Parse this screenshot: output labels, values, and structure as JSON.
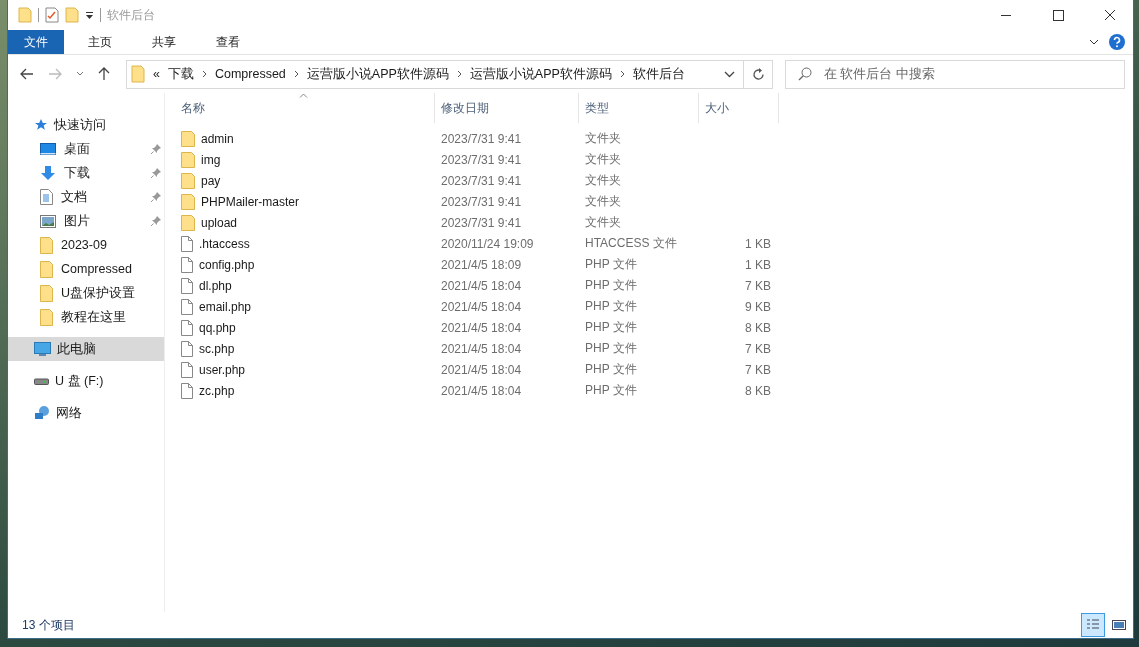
{
  "window": {
    "title": "软件后台"
  },
  "ribbon_tabs": [
    {
      "label": "文件",
      "selected": true
    },
    {
      "label": "主页",
      "selected": false
    },
    {
      "label": "共享",
      "selected": false
    },
    {
      "label": "查看",
      "selected": false
    }
  ],
  "address": {
    "overflow": "«",
    "path": [
      "下载",
      "Compressed",
      "运营版小说APP软件源码",
      "运营版小说APP软件源码",
      "软件后台"
    ]
  },
  "search": {
    "placeholder": "在 软件后台 中搜索"
  },
  "sidebar": {
    "items": [
      {
        "kind": "star",
        "label": "快速访问",
        "pinned": false,
        "selected": false
      },
      {
        "kind": "desktop",
        "label": "桌面",
        "pinned": true,
        "selected": false
      },
      {
        "kind": "download",
        "label": "下载",
        "pinned": true,
        "selected": false
      },
      {
        "kind": "document",
        "label": "文档",
        "pinned": true,
        "selected": false
      },
      {
        "kind": "picture",
        "label": "图片",
        "pinned": true,
        "selected": false
      },
      {
        "kind": "folder",
        "label": "2023-09",
        "pinned": false,
        "selected": false
      },
      {
        "kind": "folder",
        "label": "Compressed",
        "pinned": false,
        "selected": false
      },
      {
        "kind": "folder",
        "label": "U盘保护设置",
        "pinned": false,
        "selected": false
      },
      {
        "kind": "folder",
        "label": "教程在这里",
        "pinned": false,
        "selected": false
      },
      {
        "kind": "computer",
        "label": "此电脑",
        "pinned": false,
        "selected": true
      },
      {
        "kind": "drive",
        "label": "U 盘 (F:)",
        "pinned": false,
        "selected": false
      },
      {
        "kind": "network",
        "label": "网络",
        "pinned": false,
        "selected": false
      }
    ]
  },
  "table": {
    "columns": [
      "名称",
      "修改日期",
      "类型",
      "大小"
    ],
    "rows": [
      {
        "kind": "folder",
        "name": "admin",
        "date": "2023/7/31 9:41",
        "type": "文件夹",
        "size": ""
      },
      {
        "kind": "folder",
        "name": "img",
        "date": "2023/7/31 9:41",
        "type": "文件夹",
        "size": ""
      },
      {
        "kind": "folder",
        "name": "pay",
        "date": "2023/7/31 9:41",
        "type": "文件夹",
        "size": ""
      },
      {
        "kind": "folder",
        "name": "PHPMailer-master",
        "date": "2023/7/31 9:41",
        "type": "文件夹",
        "size": ""
      },
      {
        "kind": "folder",
        "name": "upload",
        "date": "2023/7/31 9:41",
        "type": "文件夹",
        "size": ""
      },
      {
        "kind": "file",
        "name": ".htaccess",
        "date": "2020/11/24 19:09",
        "type": "HTACCESS 文件",
        "size": "1 KB"
      },
      {
        "kind": "file",
        "name": "config.php",
        "date": "2021/4/5 18:09",
        "type": "PHP 文件",
        "size": "1 KB"
      },
      {
        "kind": "file",
        "name": "dl.php",
        "date": "2021/4/5 18:04",
        "type": "PHP 文件",
        "size": "7 KB"
      },
      {
        "kind": "file",
        "name": "email.php",
        "date": "2021/4/5 18:04",
        "type": "PHP 文件",
        "size": "9 KB"
      },
      {
        "kind": "file",
        "name": "qq.php",
        "date": "2021/4/5 18:04",
        "type": "PHP 文件",
        "size": "8 KB"
      },
      {
        "kind": "file",
        "name": "sc.php",
        "date": "2021/4/5 18:04",
        "type": "PHP 文件",
        "size": "7 KB"
      },
      {
        "kind": "file",
        "name": "user.php",
        "date": "2021/4/5 18:04",
        "type": "PHP 文件",
        "size": "7 KB"
      },
      {
        "kind": "file",
        "name": "zc.php",
        "date": "2021/4/5 18:04",
        "type": "PHP 文件",
        "size": "8 KB"
      }
    ]
  },
  "status_bar": {
    "count": "13 个项目",
    "view_buttons": [
      {
        "kind": "details",
        "selected": true
      },
      {
        "kind": "thumbnails",
        "selected": false
      }
    ]
  }
}
